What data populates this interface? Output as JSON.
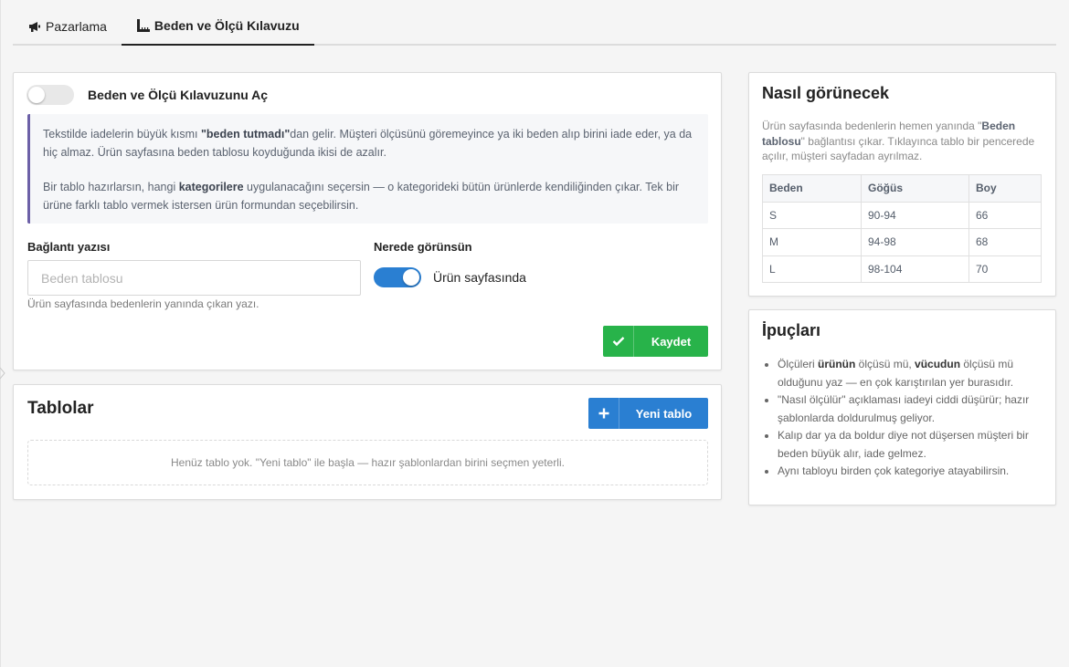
{
  "tabs": [
    {
      "label": "Pazarlama",
      "icon": "megaphone-icon",
      "active": false
    },
    {
      "label": "Beden ve Ölçü Kılavuzu",
      "icon": "ruler-icon",
      "active": true
    }
  ],
  "settings": {
    "enable_toggle_label": "Beden ve Ölçü Kılavuzunu Aç",
    "enable_toggle_on": false,
    "info_p1": {
      "a": "Tekstilde iadelerin büyük kısmı ",
      "b": "\"beden tutmadı\"",
      "c": "dan gelir. Müşteri ölçüsünü göremeyince ya iki beden alıp birini iade eder, ya da hiç almaz. Ürün sayfasına beden tablosu koyduğunda ikisi de azalır."
    },
    "info_p2": {
      "a": "Bir tablo hazırlarsın, hangi ",
      "b": "kategorilere",
      "c": " uygulanacağını seçersin — o kategorideki bütün ürünlerde kendiliğinden çıkar. Tek bir ürüne farklı tablo vermek istersen ürün formundan seçebilirsin."
    },
    "link_text_label": "Bağlantı yazısı",
    "link_text_placeholder": "Beden tablosu",
    "link_text_value": "",
    "link_text_help": "Ürün sayfasında bedenlerin yanında çıkan yazı.",
    "placement_label": "Nerede görünsün",
    "placement_option": "Ürün sayfasında",
    "placement_on": true,
    "save_button": "Kaydet"
  },
  "tables": {
    "title": "Tablolar",
    "new_button": "Yeni tablo",
    "empty_text": "Henüz tablo yok. \"Yeni tablo\" ile başla — hazır şablonlardan birini seçmen yeterli."
  },
  "preview": {
    "title": "Nasıl görünecek",
    "desc_a": "Ürün sayfasında bedenlerin hemen yanında \"",
    "desc_b": "Beden tablosu",
    "desc_c": "\" bağlantısı çıkar. Tıklayınca tablo bir pencerede açılır, müşteri sayfadan ayrılmaz.",
    "columns": [
      "Beden",
      "Göğüs",
      "Boy"
    ],
    "rows": [
      [
        "S",
        "90-94",
        "66"
      ],
      [
        "M",
        "94-98",
        "68"
      ],
      [
        "L",
        "98-104",
        "70"
      ]
    ]
  },
  "tips": {
    "title": "İpuçları",
    "items": [
      {
        "a": "Ölçüleri ",
        "b": "ürünün",
        "c": " ölçüsü mü, ",
        "d": "vücudun",
        "e": " ölçüsü mü olduğunu yaz — en çok karıştırılan yer burasıdır."
      },
      {
        "a": "\"Nasıl ölçülür\" açıklaması iadeyi ciddi düşürür; hazır şablonlarda doldurulmuş geliyor."
      },
      {
        "a": "Kalıp dar ya da boldur diye not düşersen müşteri bir beden büyük alır, iade gelmez."
      },
      {
        "a": "Aynı tabloyu birden çok kategoriye atayabilirsin."
      }
    ]
  },
  "colors": {
    "primary": "#2a7fd2",
    "success": "#28b34a",
    "info_border": "#6c60a7"
  }
}
